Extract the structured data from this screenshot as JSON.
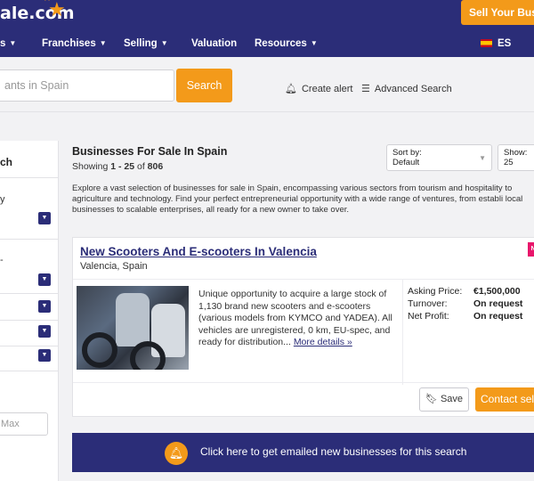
{
  "header": {
    "logo_text": "ale.com",
    "sell_button": "Sell Your Busin"
  },
  "nav": {
    "items": [
      {
        "label": "s",
        "has_chevron": true
      },
      {
        "label": "Franchises",
        "has_chevron": true
      },
      {
        "label": "Selling",
        "has_chevron": true
      },
      {
        "label": "Valuation",
        "has_chevron": false
      },
      {
        "label": "Resources",
        "has_chevron": true
      }
    ],
    "language": "ES"
  },
  "search": {
    "placeholder": "ants in Spain",
    "button_label": "Search",
    "create_alert": "Create alert",
    "advanced_search": "Advanced Search"
  },
  "sidebar": {
    "title": "ch",
    "frag1": "y",
    "frag2": "-",
    "max_placeholder": "Max"
  },
  "results": {
    "heading": "Businesses For Sale In Spain",
    "showing_prefix": "Showing ",
    "showing_range": "1 - 25",
    "showing_of": " of ",
    "showing_total": "806",
    "sort_label": "Sort by:",
    "sort_value": "Default",
    "show_label": "Show:",
    "show_value": "25",
    "description": "Explore a vast selection of businesses for sale in Spain, encompassing various sectors from tourism and hospitality to agriculture and technology. Find your perfect entrepreneurial opportunity with a wide range of ventures, from establi local businesses to scalable enterprises, all ready for a new owner to take over."
  },
  "listing": {
    "title": "New Scooters And E-scooters In Valencia",
    "location": "Valencia, Spain",
    "badge": "N",
    "description": "Unique opportunity to acquire a large stock of 1,130 brand new scooters and e-scooters (various models from KYMCO and YADEA). All vehicles are unregistered, 0 km, EU-spec, and ready for distribution...",
    "more_link": "More details »",
    "financials": [
      {
        "label": "Asking Price:",
        "value": "€1,500,000"
      },
      {
        "label": "Turnover:",
        "value": "On request"
      },
      {
        "label": "Net Profit:",
        "value": "On request"
      }
    ],
    "save_label": "Save",
    "contact_label": "Contact sel"
  },
  "banner": {
    "text": "Click here to get emailed new businesses for this search"
  },
  "colors": {
    "brand_navy": "#2b2d78",
    "accent_orange": "#f39a1a",
    "badge_pink": "#e8166b"
  }
}
